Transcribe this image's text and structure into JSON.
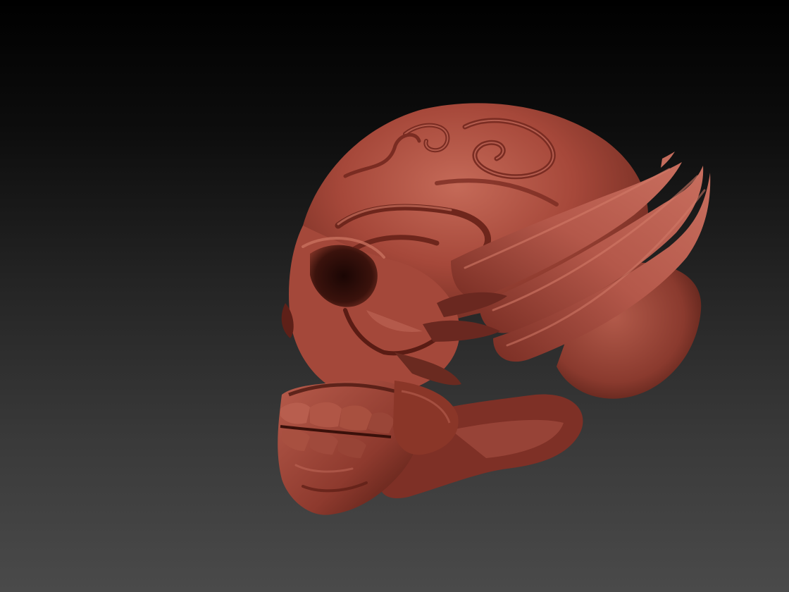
{
  "scene": {
    "subject_icon": "sculpted-skull-icon",
    "background_gradient": [
      "#000000",
      "#4a4a4a"
    ],
    "material_colors": {
      "base": "#a8483a",
      "highlight": "#c8685a",
      "shadow": "#5a2018",
      "deep_shadow": "#2a0c08"
    }
  }
}
